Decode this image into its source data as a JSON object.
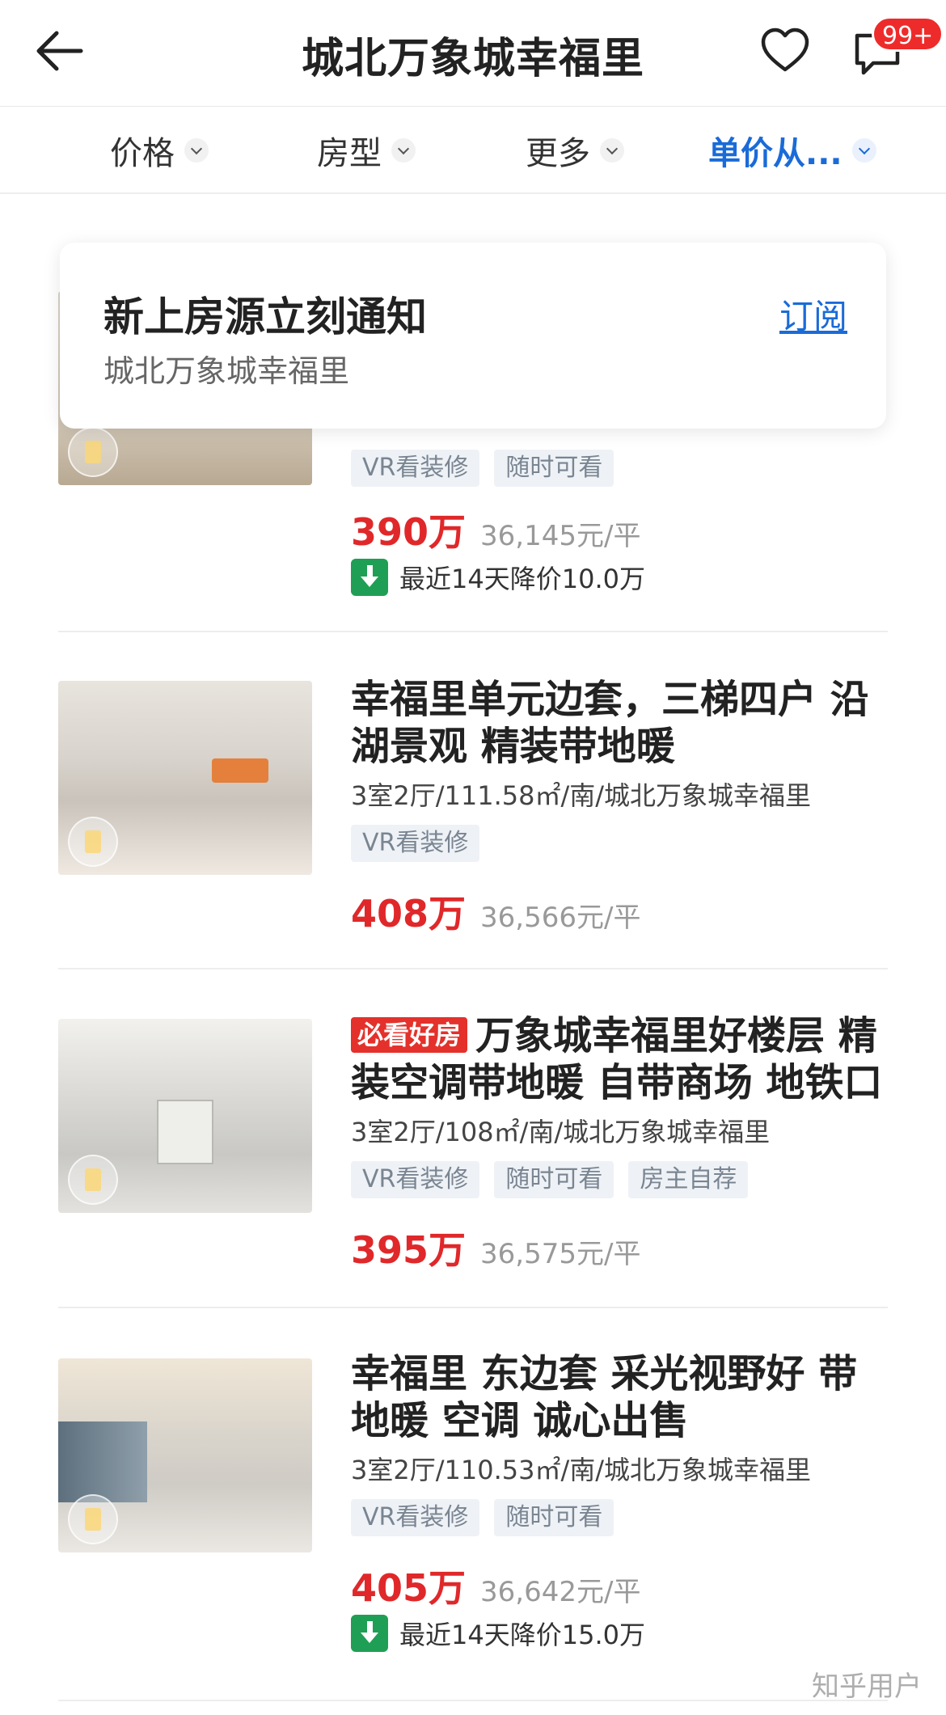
{
  "header": {
    "title": "城北万象城幸福里",
    "badge": "99+",
    "icons": {
      "back": "back-arrow-icon",
      "favorite": "heart-icon",
      "messages": "chat-icon"
    }
  },
  "filters": [
    {
      "label": "价格",
      "active": false
    },
    {
      "label": "房型",
      "active": false
    },
    {
      "label": "更多",
      "active": false
    },
    {
      "label": "单价从...",
      "active": true
    }
  ],
  "subscribe": {
    "title": "新上房源立刻通知",
    "subtitle": "城北万象城幸福里",
    "link": "订阅"
  },
  "listings": [
    {
      "title": "",
      "tags": [
        "VR看装修",
        "随时可看"
      ],
      "price": "390万",
      "unit_price": "36,145元/平",
      "price_drop": "最近14天降价10.0万"
    },
    {
      "title": "幸福里单元边套，三梯四户 沿湖景观 精装带地暖",
      "meta": "3室2厅/111.58㎡/南/城北万象城幸福里",
      "tags": [
        "VR看装修"
      ],
      "price": "408万",
      "unit_price": "36,566元/平"
    },
    {
      "badge": "必看好房",
      "title": "万象城幸福里好楼层 精装空调带地暖 自带商场 地铁口",
      "meta": "3室2厅/108㎡/南/城北万象城幸福里",
      "tags": [
        "VR看装修",
        "随时可看",
        "房主自荐"
      ],
      "price": "395万",
      "unit_price": "36,575元/平"
    },
    {
      "title": "幸福里 东边套 采光视野好 带地暖 空调 诚心出售",
      "meta": "3室2厅/110.53㎡/南/城北万象城幸福里",
      "tags": [
        "VR看装修",
        "随时可看"
      ],
      "price": "405万",
      "unit_price": "36,642元/平",
      "price_drop": "最近14天降价15.0万"
    }
  ],
  "watermark": "知乎用户",
  "colors": {
    "accent_blue": "#1a6bd8",
    "price_red": "#e0282a",
    "badge_red": "#ee2b2b",
    "drop_green": "#1f9f55"
  }
}
